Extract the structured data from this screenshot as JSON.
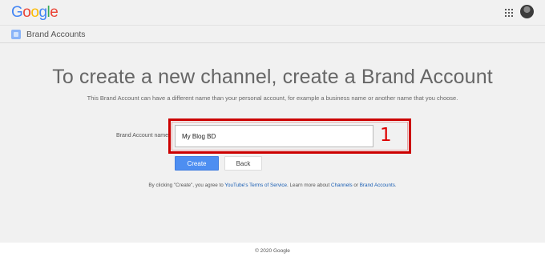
{
  "header": {
    "logo_letters": [
      "G",
      "o",
      "o",
      "g",
      "l",
      "e"
    ],
    "apps_icon": "apps-grid-icon",
    "avatar_icon": "user-avatar"
  },
  "subheader": {
    "icon": "brand-accounts-icon",
    "title": "Brand Accounts"
  },
  "main": {
    "title": "To create a new channel, create a Brand Account",
    "subtitle": "This Brand Account can have a different name than your personal account, for example a business name or another name that you choose.",
    "form": {
      "label": "Brand Account name",
      "value": "My Blog BD",
      "annotation": "1",
      "highlight_color": "#cc0000"
    },
    "buttons": {
      "create": "Create",
      "back": "Back"
    },
    "terms": {
      "prefix": "By clicking \"Create\", you agree to ",
      "tos_link": "YouTube's Terms of Service",
      "middle": ". Learn more about ",
      "channels_link": "Channels",
      "or": " or ",
      "brand_link": "Brand Accounts",
      "suffix": "."
    }
  },
  "footer": {
    "copyright": "© 2020 Google"
  },
  "colors": {
    "accent": "#4d8ef1",
    "link": "#1a5fb4",
    "annotation": "#dd0000"
  }
}
